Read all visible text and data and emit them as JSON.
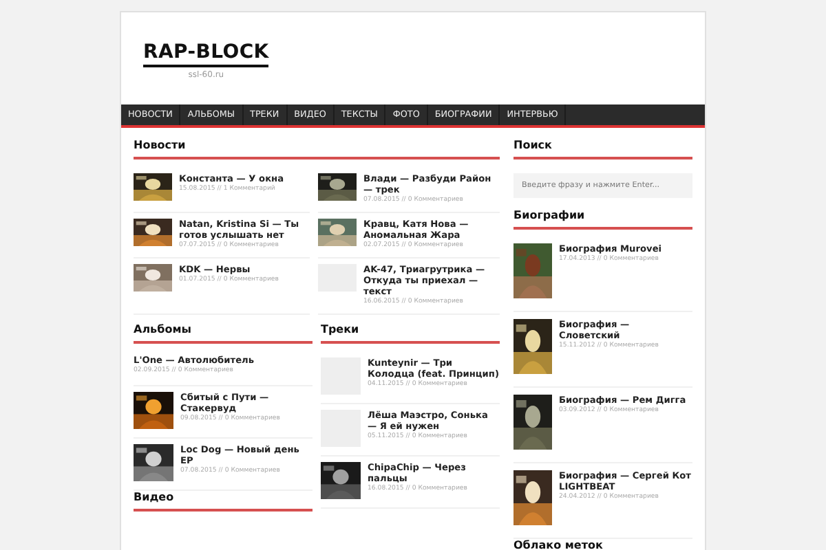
{
  "header": {
    "logo": "RAP-BLOCK",
    "tagline": "ssl-60.ru"
  },
  "nav": [
    "НОВОСТИ",
    "АЛЬБОМЫ",
    "ТРЕКИ",
    "ВИДЕО",
    "ТЕКСТЫ",
    "ФОТО",
    "БИОГРАФИИ",
    "ИНТЕРВЬЮ"
  ],
  "news": {
    "title": "Новости",
    "items": [
      {
        "title": "Константа — У окна",
        "meta": "15.08.2015 // 1 Комментарий",
        "kind": "picture"
      },
      {
        "title": "Влади — Разбуди Район — трек",
        "meta": "07.08.2015 // 0 Комментариев",
        "kind": "picture"
      },
      {
        "title": "Natan, Kristina Si — Ты готов услышать нет",
        "meta": "07.07.2015 // 0 Комментариев",
        "kind": "picture"
      },
      {
        "title": "Кравц, Катя Нова — Аномальная Жара",
        "meta": "02.07.2015 // 0 Комментариев",
        "kind": "picture"
      },
      {
        "title": "KDK — Нервы",
        "meta": "01.07.2015 // 0 Комментариев",
        "kind": "picture"
      },
      {
        "title": "AK-47, Триагрутрика — Откуда ты приехал — текст",
        "meta": "16.06.2015 // 0 Комментариев",
        "kind": "placeholder"
      }
    ]
  },
  "albums": {
    "title": "Альбомы",
    "items": [
      {
        "title": "L'One — Автолюбитель",
        "meta": "02.09.2015 // 0 Комментариев",
        "kind": "text"
      },
      {
        "title": "Сбитый с Пути — Стакервуд",
        "meta": "09.08.2015 // 0 Комментариев",
        "kind": "picture"
      },
      {
        "title": "Loc Dog — Новый день EP",
        "meta": "07.08.2015 // 0 Комментариев",
        "kind": "picture"
      }
    ]
  },
  "tracks": {
    "title": "Треки",
    "items": [
      {
        "title": "Kunteynir — Три Колодца (feat. Принцип)",
        "meta": "04.11.2015 // 0 Комментариев",
        "kind": "placeholder"
      },
      {
        "title": "Лёша Маэстро, Сонька — Я ей нужен",
        "meta": "05.11.2015 // 0 Комментариев",
        "kind": "placeholder"
      },
      {
        "title": "ChipaChip — Через пальцы",
        "meta": "16.08.2015 // 0 Комментариев",
        "kind": "picture"
      }
    ]
  },
  "video": {
    "title": "Видео"
  },
  "search": {
    "title": "Поиск",
    "placeholder": "Введите фразу и нажмите Enter..."
  },
  "bios": {
    "title": "Биографии",
    "items": [
      {
        "title": "Биография Murovei",
        "meta": "17.04.2013 // 0 Комментариев",
        "kind": "picture"
      },
      {
        "title": "Биография — Словетский",
        "meta": "15.11.2012 // 0 Комментариев",
        "kind": "picture"
      },
      {
        "title": "Биография — Рем Дигга",
        "meta": "03.09.2012 // 0 Комментариев",
        "kind": "picture"
      },
      {
        "title": "Биография — Сергей Кот LIGHTBEAT",
        "meta": "24.04.2012 // 0 Комментариев",
        "kind": "picture"
      }
    ]
  },
  "tags": {
    "title": "Облако меток"
  }
}
